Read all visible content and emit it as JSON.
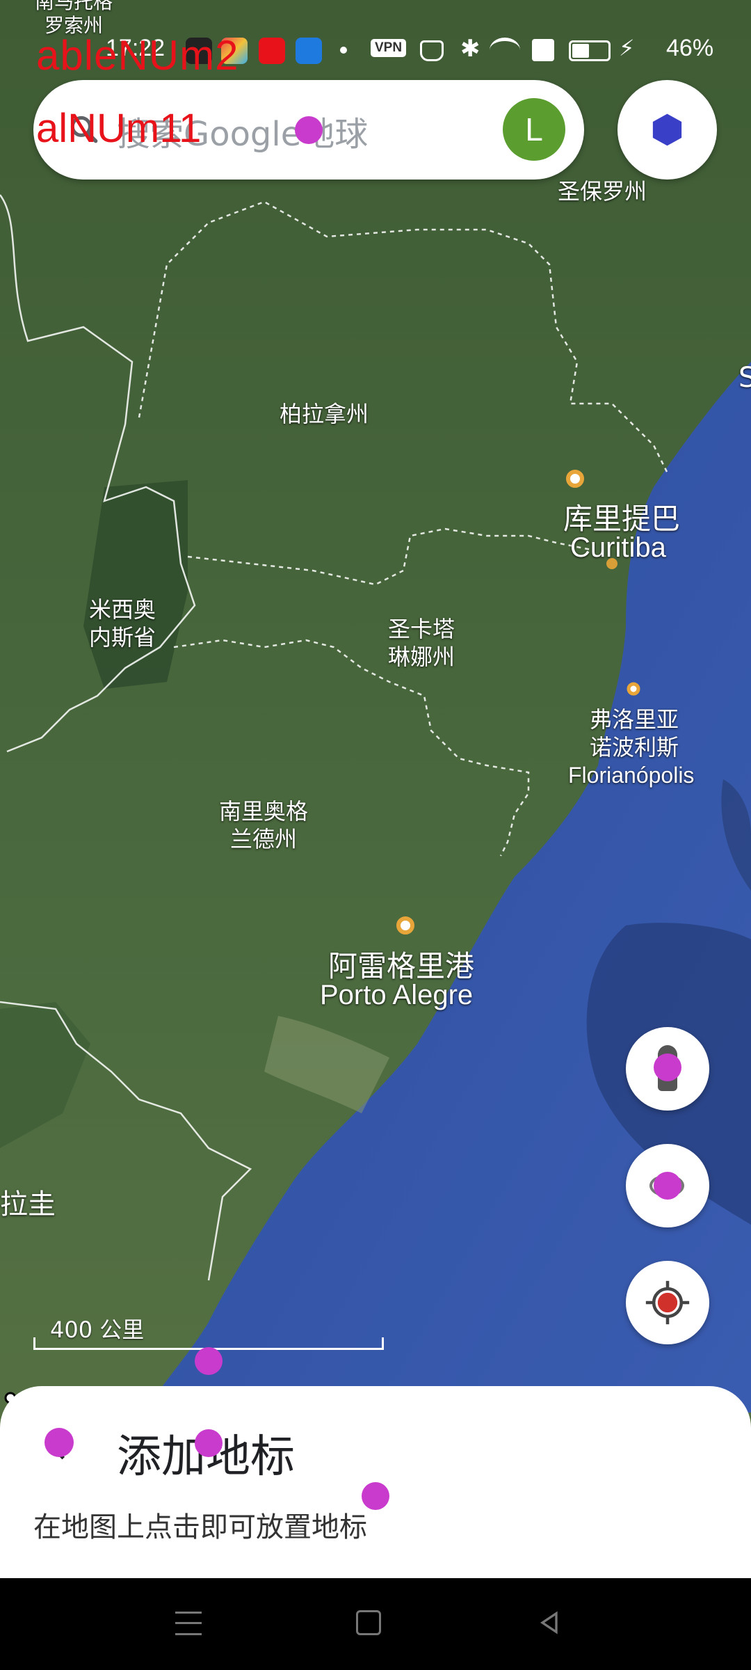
{
  "status_bar": {
    "time": "17:22",
    "vpn": "VPN",
    "battery": "46%"
  },
  "debug_overlay": {
    "title_text": "ableNUm2",
    "search_overlay_text": "alNUm11"
  },
  "search": {
    "placeholder": "搜索Google地球",
    "avatar_letter": "L"
  },
  "map": {
    "labels": {
      "sao_paulo_state": "圣保罗州",
      "parana_state": "柏拉拿州",
      "mato_grosso_do_sul": "米西奥\n内斯省",
      "santa_catarina": "圣卡塔\n琳娜州",
      "rio_grande_do_sul": "南里奥格\n兰德州",
      "curitiba_cn": "库里提巴",
      "curitiba_en": "Curitiba",
      "florianopolis_cn": "弗洛里亚\n诺波利斯",
      "florianopolis_en": "Florianópolis",
      "porto_alegre_cn": "阿雷格里港",
      "porto_alegre_en": "Porto Alegre",
      "uruguay_partial": "拉圭",
      "top_left_partial": "南马托格\n罗索州",
      "edge_s": "S"
    },
    "scale": "400 公里"
  },
  "bottom_sheet": {
    "title": "添加地标",
    "subtitle": "在地图上点击即可放置地标"
  },
  "colors": {
    "ocean": "#3b5aa6",
    "land": "#4a6a3c",
    "accent_pin": "#c93bcc",
    "avatar": "#5b9e2f"
  }
}
